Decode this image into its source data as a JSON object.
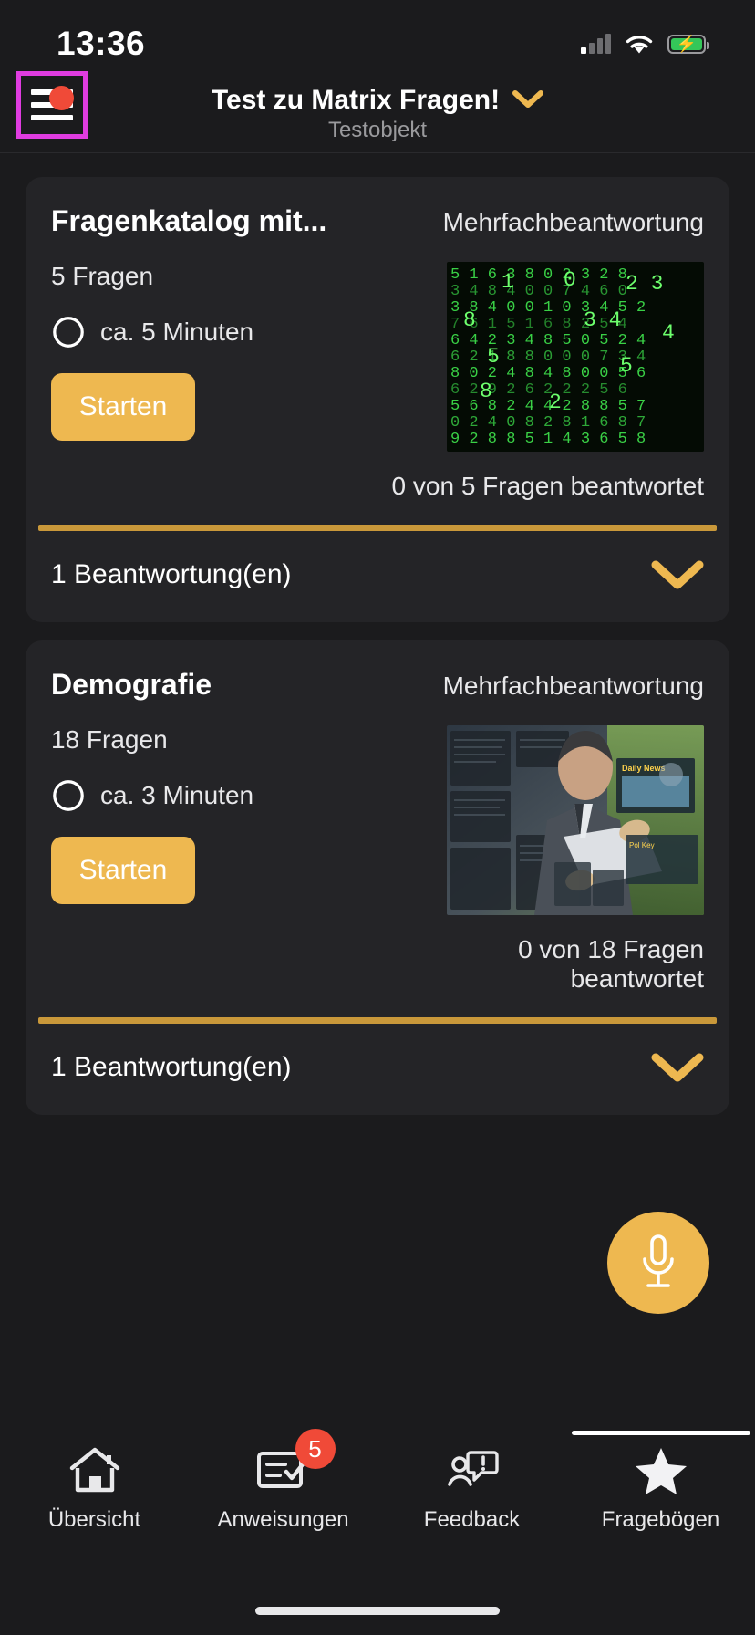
{
  "status_bar": {
    "time": "13:36",
    "signal_icon": "cellular-bars-icon",
    "wifi_icon": "wifi-icon",
    "battery_icon": "battery-charging-icon"
  },
  "header": {
    "menu_icon": "hamburger-menu-icon",
    "menu_badge_icon": "notification-dot-icon",
    "title": "Test zu Matrix Fragen!",
    "subtitle": "Testobjekt",
    "dropdown_icon": "chevron-down-icon"
  },
  "cards": [
    {
      "title": "Fragenkatalog mit...",
      "type": "Mehrfachbeantwortung",
      "question_count": "5 Fragen",
      "clock_icon": "clock-icon",
      "duration": "ca. 5 Minuten",
      "start_label": "Starten",
      "thumbnail_icon": "matrix-digits-image",
      "answered": "0 von 5 Fragen beantwortet",
      "expand_label": "1 Beantwortung(en)",
      "expand_icon": "chevron-down-icon"
    },
    {
      "title": "Demografie",
      "type": "Mehrfachbeantwortung",
      "question_count": "18 Fragen",
      "clock_icon": "clock-icon",
      "duration": "ca. 3 Minuten",
      "start_label": "Starten",
      "thumbnail_icon": "businessman-tablet-image",
      "answered": "0 von 18 Fragen beantwortet",
      "expand_label": "1 Beantwortung(en)",
      "expand_icon": "chevron-down-icon"
    }
  ],
  "fab": {
    "icon": "microphone-icon"
  },
  "tabbar": {
    "items": [
      {
        "label": "Übersicht",
        "icon": "home-icon",
        "badge": "",
        "active": false
      },
      {
        "label": "Anweisungen",
        "icon": "checklist-icon",
        "badge": "5",
        "active": false
      },
      {
        "label": "Feedback",
        "icon": "person-comment-icon",
        "badge": "",
        "active": false
      },
      {
        "label": "Fragebögen",
        "icon": "star-icon",
        "badge": "",
        "active": true
      }
    ]
  },
  "colors": {
    "background": "#1b1b1d",
    "card": "#242427",
    "accent": "#eeb850",
    "rule": "#c9983a",
    "badge": "#f04a38",
    "highlight": "#e03ce0"
  }
}
